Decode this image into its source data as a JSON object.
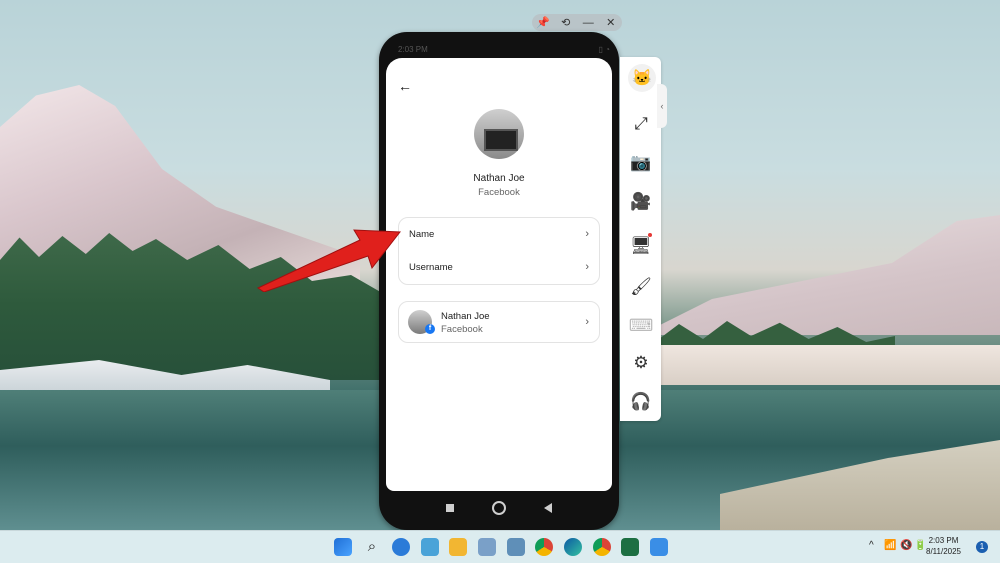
{
  "window_controls": {
    "pin": "📌",
    "history": "⟲",
    "minimize": "—",
    "close": "✕"
  },
  "phone_status": {
    "left": "2:03 PM",
    "right": "▯ ◔"
  },
  "screen": {
    "back_icon": "←",
    "profile": {
      "name": "Nathan Joe",
      "source": "Facebook"
    },
    "options": [
      {
        "label": "Name",
        "chevron": "›"
      },
      {
        "label": "Username",
        "chevron": "›"
      }
    ],
    "account": {
      "name": "Nathan Joe",
      "source": "Facebook",
      "chevron": "›",
      "badge": "f"
    }
  },
  "sidebar": {
    "collapse_icon": "‹",
    "icons": [
      "fullscreen-icon",
      "screenshot-icon",
      "record-icon",
      "cast-icon",
      "brush-icon",
      "keyboard-icon",
      "settings-icon",
      "support-icon"
    ],
    "glyphs": {
      "fullscreen": "⤢",
      "screenshot": "📷",
      "record": "🎥",
      "cast": "🖥",
      "brush": "🖌",
      "keyboard": "⌨",
      "settings": "⚙",
      "support": "🎧",
      "mascot": "🐱"
    }
  },
  "taskbar": {
    "clock_time": "2:03 PM",
    "clock_date": "8/11/2025",
    "notification_count": "1",
    "tray": {
      "chevron": "^",
      "wifi": "📶",
      "volume": "🔇",
      "battery": "🔋"
    }
  },
  "colors": {
    "arrow": "#e0201c",
    "facebook": "#1877f2",
    "accent": "#1b5fb0"
  }
}
